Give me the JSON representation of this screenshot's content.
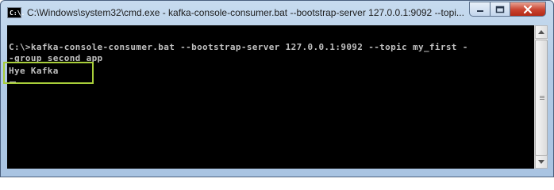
{
  "window": {
    "title": "C:\\Windows\\system32\\cmd.exe - kafka-console-consumer.bat  --bootstrap-server 127.0.0.1:9092 --topi...",
    "icon_label": "C:\\."
  },
  "console": {
    "lines": [
      "C:\\>kafka-console-consumer.bat --bootstrap-server 127.0.0.1:9092 --topic my_first -",
      "-group second_app",
      "Hye Kafka"
    ]
  },
  "colors": {
    "console_bg": "#000000",
    "console_text": "#c0c0c0",
    "highlight": "#a8ce3a",
    "close_button": "#c94330"
  },
  "icons": [
    "cmd-app-icon",
    "minimize-icon",
    "maximize-icon",
    "close-icon",
    "scroll-up-arrow-icon",
    "scroll-down-arrow-icon"
  ]
}
